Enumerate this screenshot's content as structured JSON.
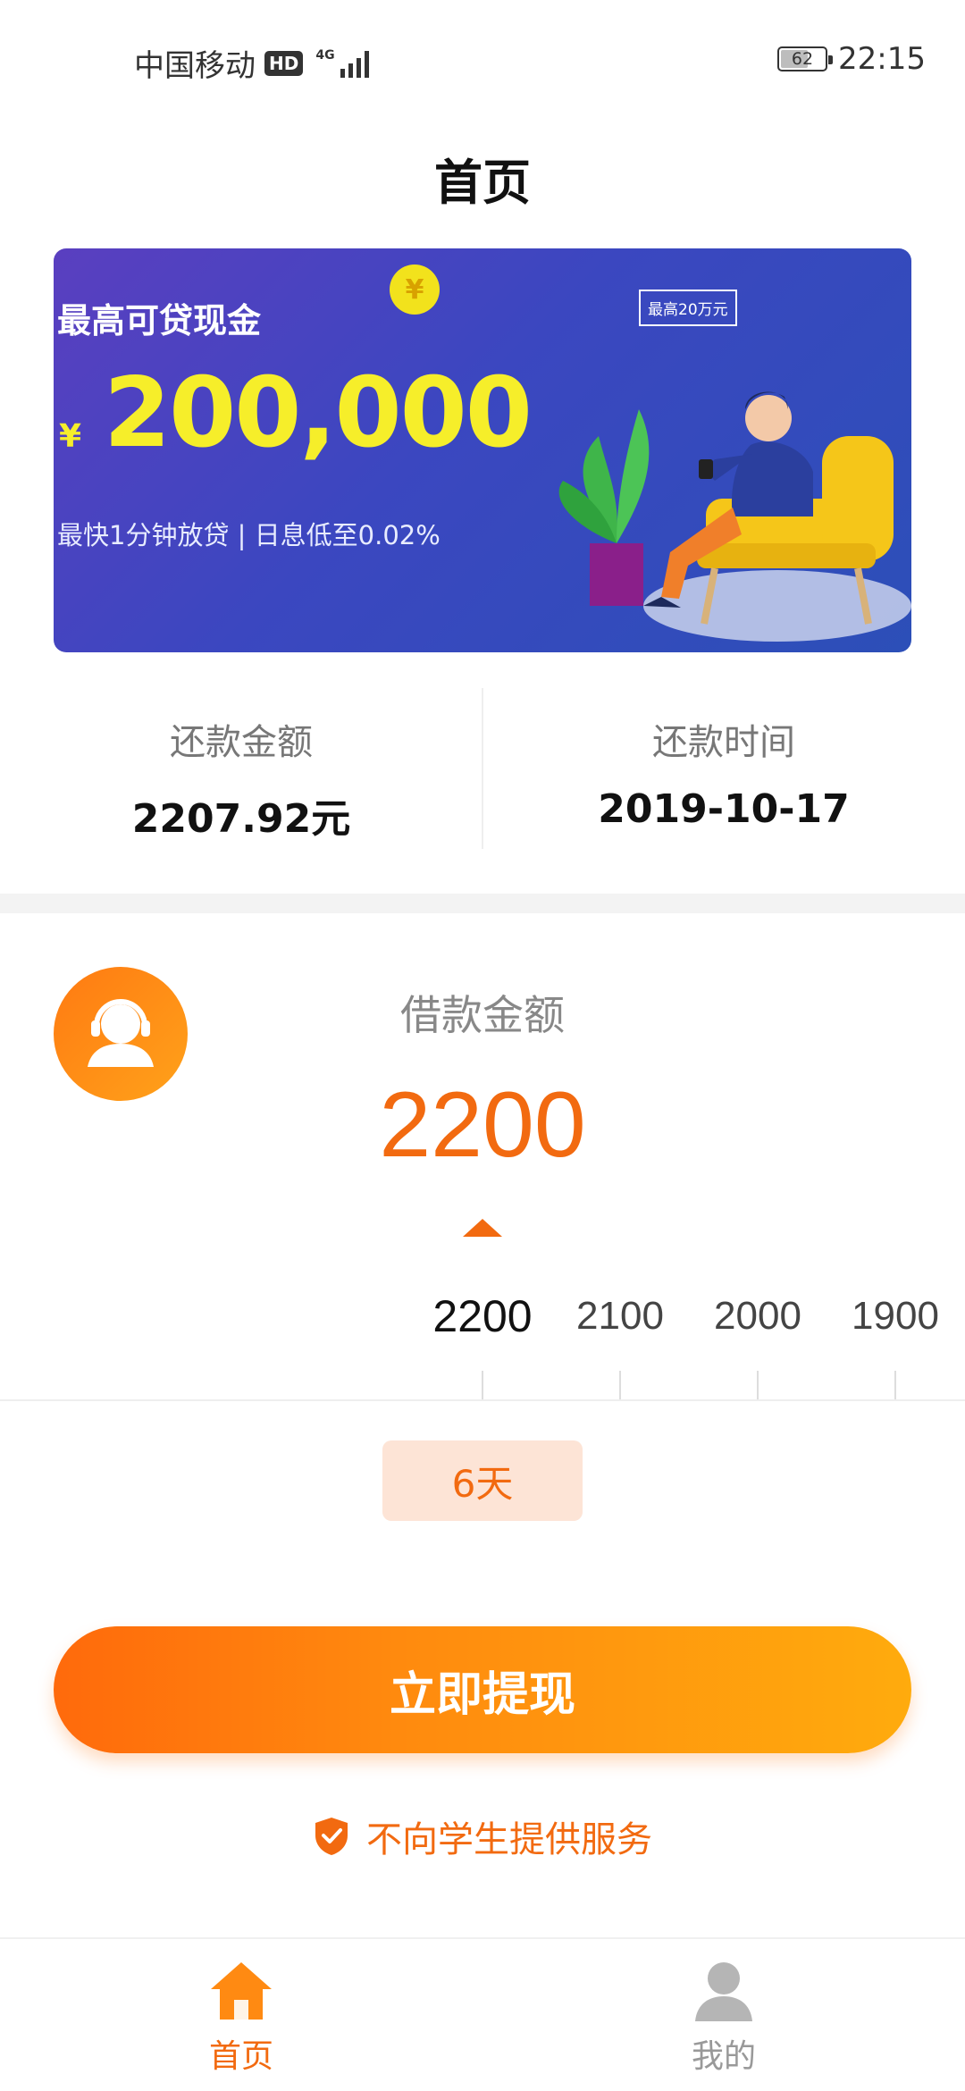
{
  "status_bar": {
    "carrier": "中国移动",
    "hd": "HD",
    "network": "4G",
    "battery": "62",
    "battery_level": 0.62,
    "time": "22:15"
  },
  "page": {
    "title": "首页"
  },
  "banner": {
    "headline": "最高可贷现金",
    "currency_symbol": "¥",
    "amount": "200,000",
    "subline": "最快1分钟放贷 | 日息低至0.02%",
    "coin_symbol": "¥",
    "tag": "最高20万元"
  },
  "repayment": {
    "amount_label": "还款金额",
    "amount_value": "2207.92元",
    "date_label": "还款时间",
    "date_value": "2019-10-17"
  },
  "loan": {
    "label": "借款金额",
    "amount": "2200",
    "ruler_values": [
      "2200",
      "2100",
      "2000",
      "1900"
    ],
    "term": "6天"
  },
  "actions": {
    "withdraw": "立即提现"
  },
  "notice": {
    "text": "不向学生提供服务"
  },
  "nav": {
    "home": "首页",
    "mine": "我的"
  },
  "colors": {
    "accent": "#f26a10",
    "banner_bg": "#3b47c0",
    "banner_highlight": "#f6ee2a"
  }
}
